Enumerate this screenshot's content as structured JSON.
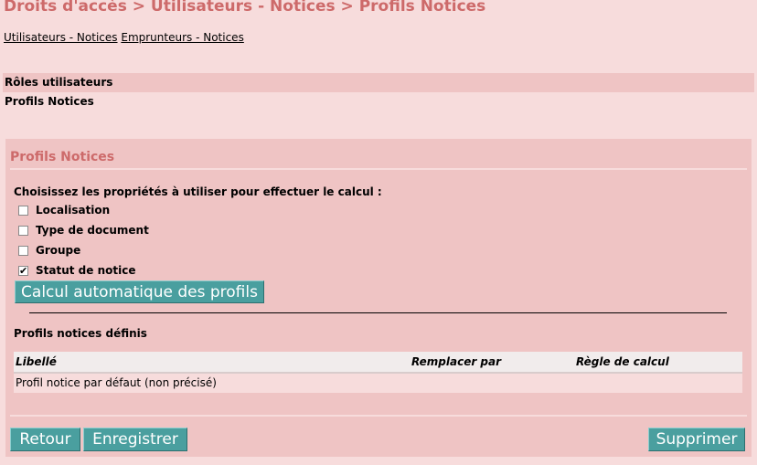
{
  "page": {
    "title": "Droits d'accès > Utilisateurs - Notices > Profils Notices"
  },
  "sublinks": {
    "link1": "Utilisateurs - Notices",
    "link2": "Emprunteurs - Notices"
  },
  "menu": {
    "roles": "Rôles utilisateurs",
    "profils": "Profils Notices"
  },
  "panel": {
    "title": "Profils Notices",
    "choose_label": "Choisissez les propriétés à utiliser pour effectuer le calcul :",
    "checkboxes": [
      {
        "label": "Localisation",
        "checked": false
      },
      {
        "label": "Type de document",
        "checked": false
      },
      {
        "label": "Groupe",
        "checked": false
      },
      {
        "label": "Statut de notice",
        "checked": true
      }
    ],
    "calc_button": "Calcul automatique des profils",
    "defined_label": "Profils notices définis",
    "table": {
      "headers": [
        "Libellé",
        "Remplacer par",
        "Règle de calcul"
      ],
      "rows": [
        [
          "Profil notice par défaut (non précisé)",
          "",
          ""
        ]
      ]
    }
  },
  "actions": {
    "back": "Retour",
    "save": "Enregistrer",
    "delete": "Supprimer"
  },
  "colors": {
    "background": "#f7dcdc",
    "panel": "#efc4c4",
    "title": "#cd6a6a",
    "button": "#4a9f9f"
  }
}
